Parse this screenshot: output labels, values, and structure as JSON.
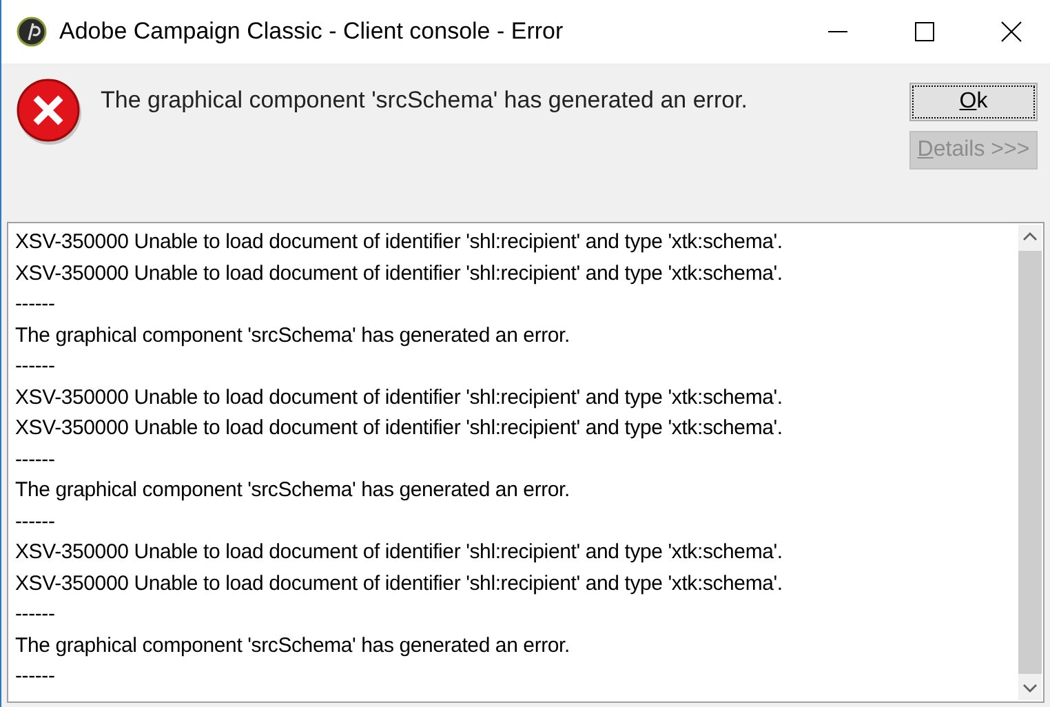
{
  "window": {
    "title": "Adobe Campaign Classic - Client console - Error"
  },
  "message": "The graphical component 'srcSchema' has generated an error.",
  "buttons": [
    {
      "label": "Ok",
      "disabled": false,
      "focused": true
    },
    {
      "label": "Details >>>",
      "disabled": true,
      "focused": false
    }
  ],
  "log": [
    "XSV-350000 Unable to load document of identifier 'shl:recipient' and type 'xtk:schema'.",
    "XSV-350000 Unable to load document of identifier 'shl:recipient' and type 'xtk:schema'.",
    "------",
    "The graphical component 'srcSchema' has generated an error.",
    "------",
    "XSV-350000 Unable to load document of identifier 'shl:recipient' and type 'xtk:schema'.",
    "XSV-350000 Unable to load document of identifier 'shl:recipient' and type 'xtk:schema'.",
    "------",
    "The graphical component 'srcSchema' has generated an error.",
    "------",
    "XSV-350000 Unable to load document of identifier 'shl:recipient' and type 'xtk:schema'.",
    "XSV-350000 Unable to load document of identifier 'shl:recipient' and type 'xtk:schema'.",
    "------",
    "The graphical component 'srcSchema' has generated an error.",
    "------"
  ]
}
